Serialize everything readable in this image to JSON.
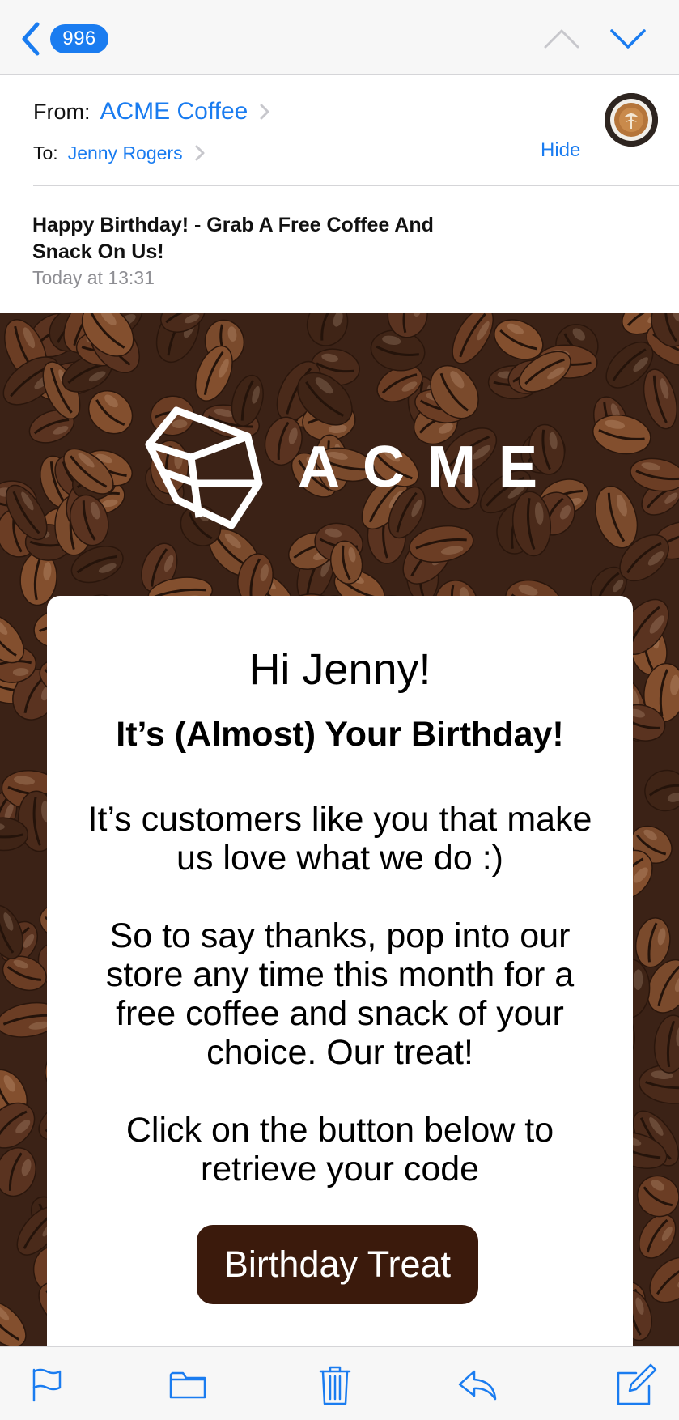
{
  "nav": {
    "unread_count": "996"
  },
  "header": {
    "from_label": "From:",
    "from_name": "ACME Coffee",
    "to_label": "To:",
    "to_name": "Jenny Rogers",
    "hide_label": "Hide"
  },
  "message": {
    "subject": "Happy Birthday! - Grab A Free Coffee And Snack On Us!",
    "timestamp": "Today at 13:31"
  },
  "email": {
    "brand": "ACME",
    "greeting": "Hi Jenny!",
    "headline": "It’s (Almost) Your Birthday!",
    "paragraph1": "It’s customers like you that make us love what we do :)",
    "paragraph2": "So to say thanks, pop into our store any time this month for a free coffee and snack of your choice. Our treat!",
    "paragraph3": "Click on the button below to retrieve your code",
    "button_label": "Birthday Treat"
  },
  "colors": {
    "accent": "#1a7cf0",
    "button": "#3b1a0c",
    "bean_background": "#3b2216"
  },
  "icons": {
    "back": "chevron-left-icon",
    "prev": "chevron-up-icon",
    "next": "chevron-down-icon",
    "flag": "flag-icon",
    "folder": "folder-icon",
    "trash": "trash-icon",
    "reply": "reply-icon",
    "compose": "compose-icon"
  }
}
